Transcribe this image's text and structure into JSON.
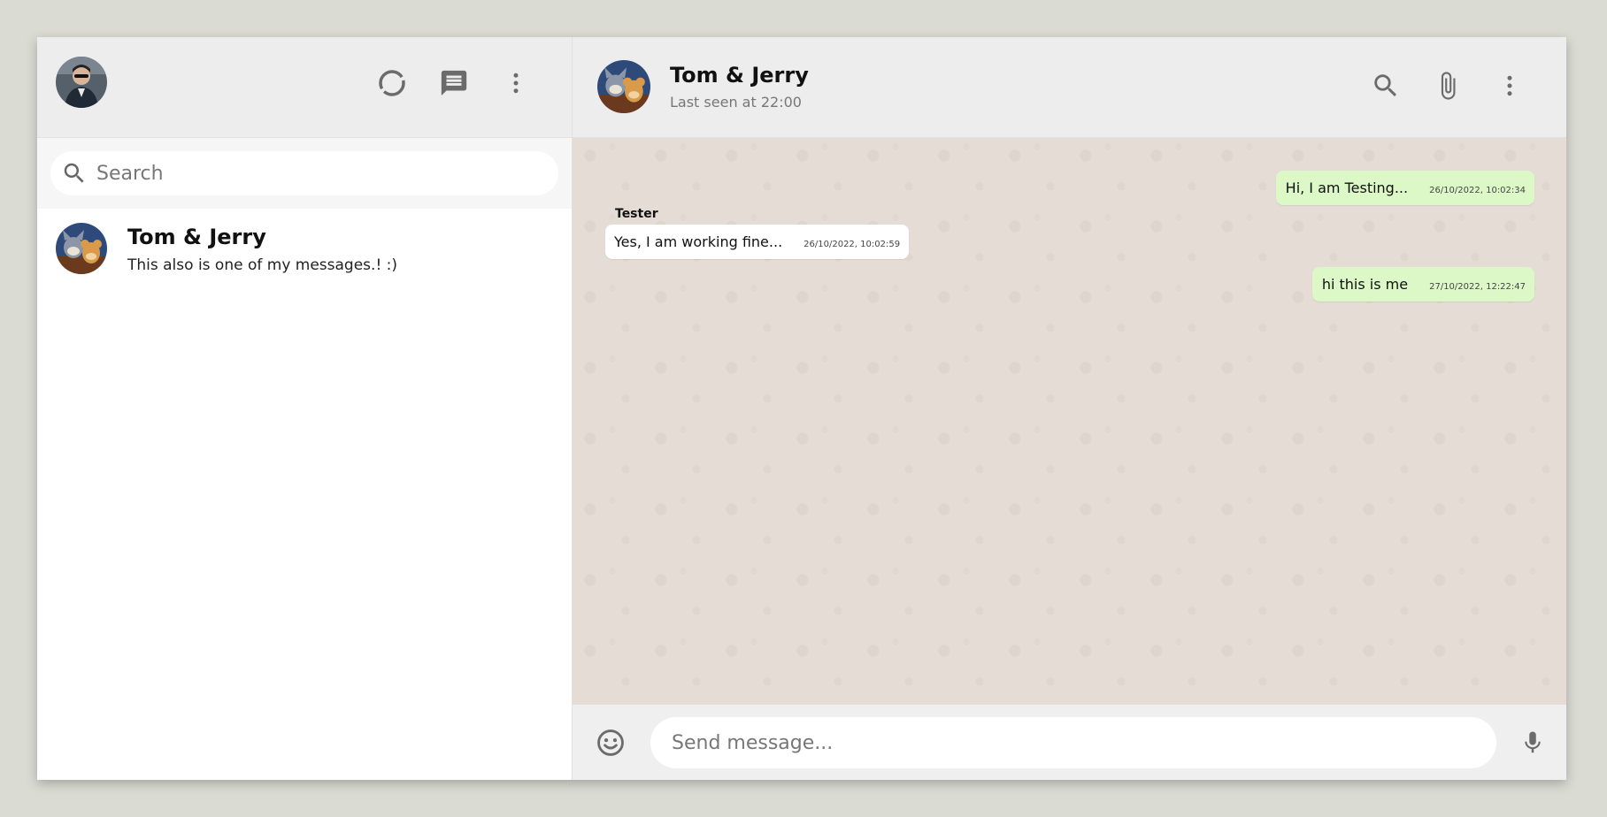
{
  "colors": {
    "accent": "#dcf8c6",
    "chat_background": "#e5ddd5",
    "panel_header": "#ededed",
    "icon_gray": "#6b6b6b"
  },
  "sidebar": {
    "icons": [
      "status-icon",
      "new-chat-icon",
      "menu-icon"
    ],
    "search": {
      "placeholder": "Search",
      "value": ""
    },
    "chats": [
      {
        "name": "Tom & Jerry",
        "last_message": "This also is one of my messages.! :)"
      }
    ]
  },
  "chat": {
    "header": {
      "name": "Tom & Jerry",
      "status": "Last seen at 22:00"
    },
    "header_icons": [
      "search-icon",
      "attach-icon",
      "menu-icon"
    ],
    "messages": [
      {
        "direction": "out",
        "sender": "",
        "text": "Hi, I am Testing...",
        "time": "26/10/2022, 10:02:34"
      },
      {
        "direction": "in",
        "sender": "Tester",
        "text": "Yes, I am working fine...",
        "time": "26/10/2022, 10:02:59"
      },
      {
        "direction": "out",
        "sender": "",
        "text": "hi this is me",
        "time": "27/10/2022, 12:22:47"
      }
    ],
    "composer": {
      "placeholder": "Send message...",
      "value": ""
    }
  }
}
